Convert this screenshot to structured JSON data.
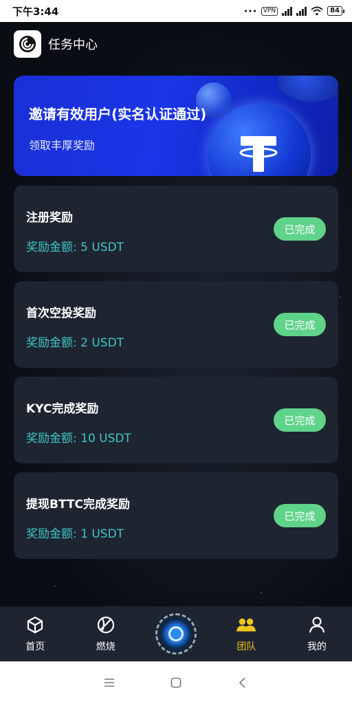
{
  "status_bar": {
    "time": "下午3:44",
    "dots": "•••",
    "vpn": "VPN",
    "battery": "84"
  },
  "header": {
    "title": "任务中心"
  },
  "banner": {
    "title": "邀请有效用户(实名认证通过)",
    "subtitle": "领取丰厚奖励"
  },
  "tasks": [
    {
      "title": "注册奖励",
      "reward": "奖励金额: 5 USDT",
      "status": "已完成"
    },
    {
      "title": "首次空投奖励",
      "reward": "奖励金额: 2 USDT",
      "status": "已完成"
    },
    {
      "title": "KYC完成奖励",
      "reward": "奖励金额: 10 USDT",
      "status": "已完成"
    },
    {
      "title": "提现BTTC完成奖励",
      "reward": "奖励金额: 1 USDT",
      "status": "已完成"
    }
  ],
  "bottom_nav": {
    "items": [
      {
        "label": "首页",
        "icon": "cube-icon"
      },
      {
        "label": "燃烧",
        "icon": "ball-icon"
      },
      {
        "label": "",
        "icon": "center-orb-icon"
      },
      {
        "label": "团队",
        "icon": "team-icon",
        "active": true
      },
      {
        "label": "我的",
        "icon": "user-icon"
      }
    ],
    "active_color": "#f0c51e"
  },
  "colors": {
    "accent_teal": "#3ec8c8",
    "status_green": "#5fd38a",
    "banner_blue": "#1a36e8"
  }
}
